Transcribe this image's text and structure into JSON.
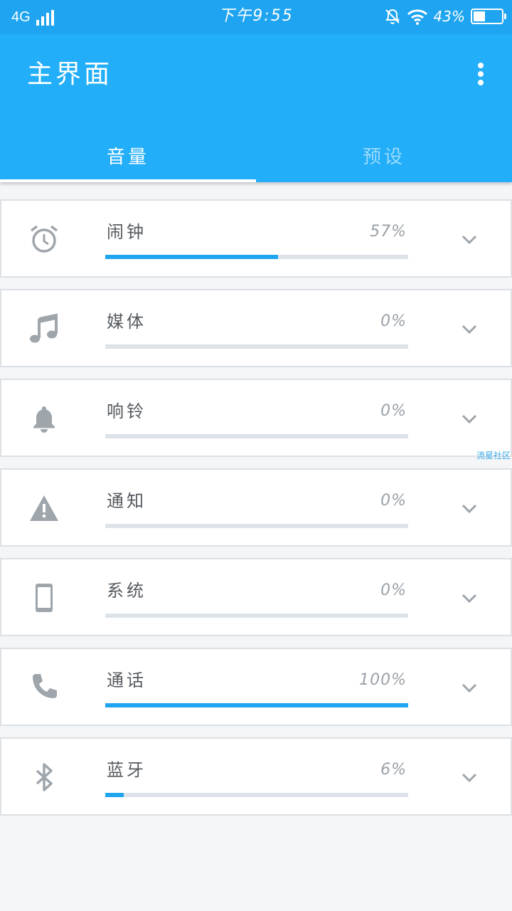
{
  "status_bar": {
    "network": "4G",
    "time": "下午9:55",
    "battery_text": "43%",
    "battery_level": 0.43
  },
  "app_bar": {
    "title": "主界面",
    "menu_icon": "more-vertical-icon"
  },
  "tabs": [
    {
      "label": "音量",
      "active": true
    },
    {
      "label": "预设",
      "active": false
    }
  ],
  "volume_items": [
    {
      "label": "闹钟",
      "percent_text": "57%",
      "level": 0.57,
      "icon": "alarm-clock-icon"
    },
    {
      "label": "媒体",
      "percent_text": "0%",
      "level": 0,
      "icon": "music-note-icon"
    },
    {
      "label": "响铃",
      "percent_text": "0%",
      "level": 0,
      "icon": "bell-icon"
    },
    {
      "label": "通知",
      "percent_text": "0%",
      "level": 0,
      "icon": "warning-icon"
    },
    {
      "label": "系统",
      "percent_text": "0%",
      "level": 0,
      "icon": "phone-device-icon"
    },
    {
      "label": "通话",
      "percent_text": "100%",
      "level": 1.0,
      "icon": "phone-call-icon"
    },
    {
      "label": "蓝牙",
      "percent_text": "6%",
      "level": 0.06,
      "icon": "bluetooth-icon"
    }
  ],
  "watermark": "流星社区",
  "colors": {
    "status_bar": "#1ea4f0",
    "app_bar": "#22aef8",
    "accent": "#1fa6ef",
    "icon_gray": "#9ea5ab"
  }
}
